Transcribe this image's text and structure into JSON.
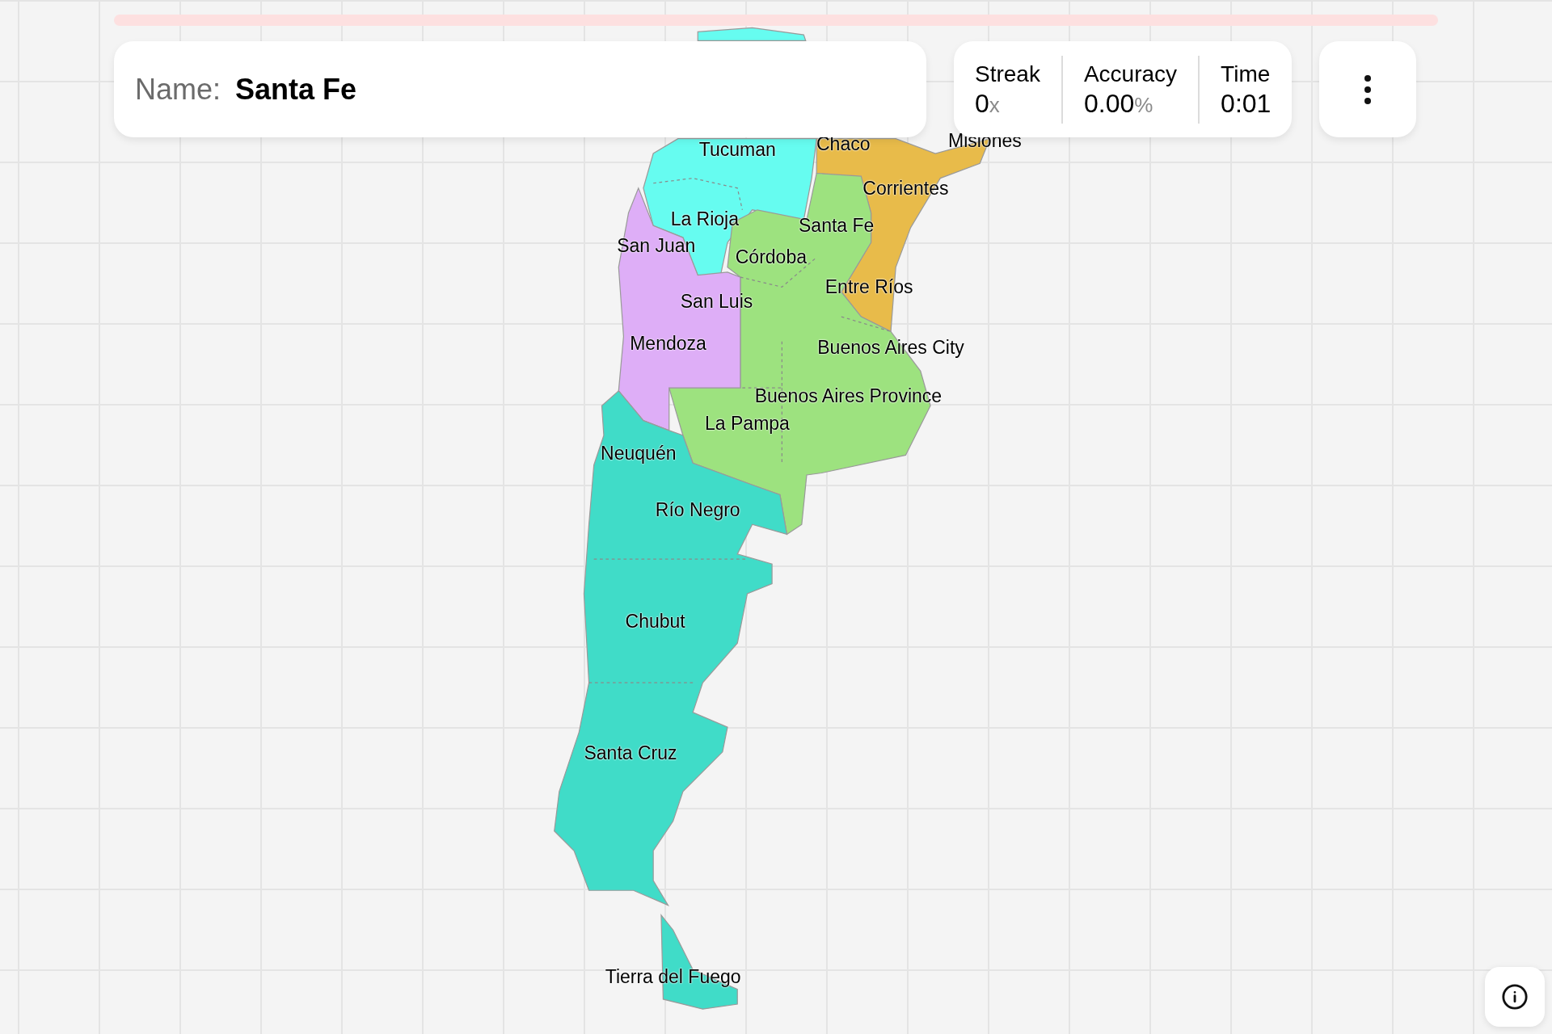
{
  "question": {
    "label": "Name:",
    "value": "Santa Fe"
  },
  "stats": [
    {
      "label": "Streak",
      "value": "0",
      "unit": "x"
    },
    {
      "label": "Accuracy",
      "value": "0.00",
      "unit": "%"
    },
    {
      "label": "Time",
      "value": "0:01"
    }
  ],
  "map": {
    "labels": [
      "Tucuman",
      "Chaco",
      "Misiones",
      "Corrientes",
      "La Rioja",
      "Santa Fe",
      "San Juan",
      "Córdoba",
      "Entre Ríos",
      "San Luis",
      "Mendoza",
      "Buenos Aires City",
      "Buenos Aires Province",
      "La Pampa",
      "Neuquén",
      "Río Negro",
      "Chubut",
      "Santa Cruz",
      "Tierra del Fuego"
    ]
  }
}
